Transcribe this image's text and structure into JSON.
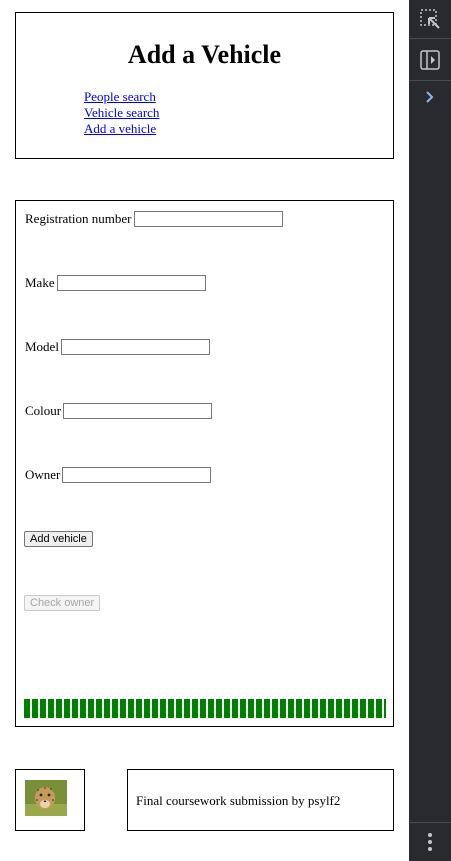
{
  "header": {
    "title": "Add a Vehicle",
    "nav": [
      {
        "label": "People search"
      },
      {
        "label": "Vehicle search"
      },
      {
        "label": "Add a vehicle"
      }
    ]
  },
  "form": {
    "fields": [
      {
        "label": "Registration number",
        "value": "",
        "placeholder": ""
      },
      {
        "label": "Make",
        "value": "",
        "placeholder": ""
      },
      {
        "label": "Model",
        "value": "",
        "placeholder": ""
      },
      {
        "label": "Colour",
        "value": "",
        "placeholder": ""
      },
      {
        "label": "Owner",
        "value": "",
        "placeholder": ""
      }
    ],
    "add_button": "Add vehicle",
    "check_owner_button": "Check owner"
  },
  "footer": {
    "avatar_icon": "cheetah-photo",
    "credit": "Final coursework submission by psylf2"
  },
  "devtools": {
    "icons": [
      "inspect-element-icon",
      "toggle-panel-icon",
      "chevron-right-icon",
      "more-options-icon"
    ]
  },
  "colors": {
    "link": "#0000ee",
    "stripe": "#008000",
    "devtools_bg": "#292a2d",
    "devtools_accent": "#8ab4f8"
  }
}
